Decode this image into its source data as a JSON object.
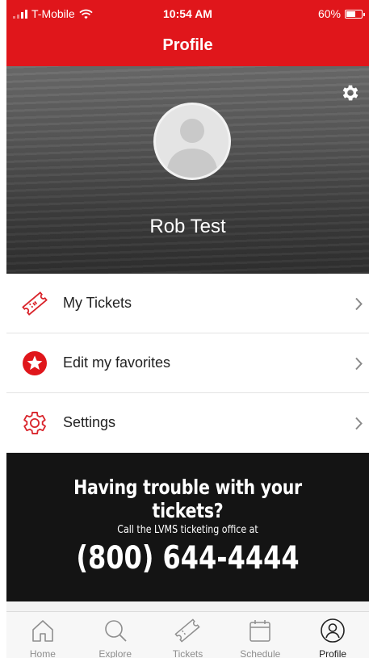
{
  "status_bar": {
    "carrier": "T-Mobile",
    "time": "10:54 AM",
    "battery": "60%",
    "signal_icon": "signal-bars-icon",
    "wifi_icon": "wifi-icon",
    "battery_icon": "battery-icon"
  },
  "header": {
    "title": "Profile"
  },
  "hero": {
    "name": "Rob Test",
    "avatar_icon": "person-placeholder-icon",
    "settings_icon": "gear-icon"
  },
  "menu": {
    "items": [
      {
        "label": "My Tickets",
        "icon": "ticket-icon"
      },
      {
        "label": "Edit my favorites",
        "icon": "star-badge-icon"
      },
      {
        "label": "Settings",
        "icon": "gear-outline-icon"
      }
    ],
    "chevron_icon": "chevron-right-icon"
  },
  "promo": {
    "title": "Having trouble with your tickets?",
    "subtitle": "Call the LVMS ticketing office at",
    "phone": "(800) 644-4444"
  },
  "tabbar": {
    "active": "Profile",
    "tabs": [
      {
        "label": "Home",
        "icon": "home-icon"
      },
      {
        "label": "Explore",
        "icon": "search-icon"
      },
      {
        "label": "Tickets",
        "icon": "ticket-icon"
      },
      {
        "label": "Schedule",
        "icon": "calendar-icon"
      },
      {
        "label": "Profile",
        "icon": "profile-icon"
      }
    ]
  },
  "colors": {
    "brand_red": "#e0161b",
    "promo_bg": "#141414",
    "tab_inactive": "#8e8e8e"
  }
}
